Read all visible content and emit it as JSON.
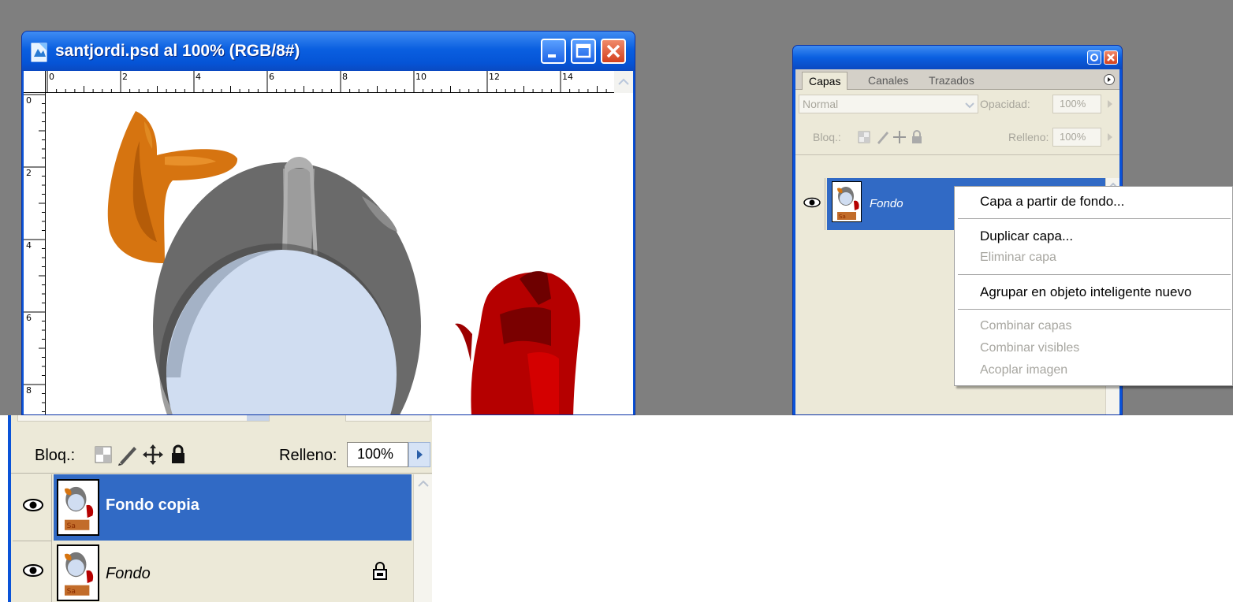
{
  "document_window": {
    "title": "santjordi.psd al 100% (RGB/8#)",
    "ruler_h": [
      "0",
      "2",
      "4",
      "6",
      "8",
      "10",
      "12",
      "14"
    ],
    "ruler_v": [
      "0",
      "2",
      "4",
      "6",
      "8"
    ]
  },
  "layers_panel": {
    "tabs": [
      "Capas",
      "Canales",
      "Trazados"
    ],
    "blend_mode": "Normal",
    "opacity_label": "Opacidad:",
    "opacity_value": "100%",
    "lock_label": "Bloq.:",
    "fill_label": "Relleno:",
    "fill_value": "100%",
    "layers": [
      {
        "name": "Fondo",
        "selected": true,
        "locked": true
      }
    ]
  },
  "context_menu": {
    "items": [
      {
        "label": "Capa a partir de fondo...",
        "enabled": true
      },
      {
        "label": "Duplicar capa...",
        "enabled": true
      },
      {
        "label": "Eliminar capa",
        "enabled": false
      },
      {
        "label": "Agrupar en objeto inteligente nuevo",
        "enabled": true
      },
      {
        "label": "Combinar capas",
        "enabled": false
      },
      {
        "label": "Combinar visibles",
        "enabled": false
      },
      {
        "label": "Acoplar imagen",
        "enabled": false
      }
    ]
  },
  "bottom_panel": {
    "lock_label": "Bloq.:",
    "fill_label": "Relleno:",
    "fill_value": "100%",
    "layers": [
      {
        "name": "Fondo copia",
        "selected": true,
        "locked": false
      },
      {
        "name": "Fondo",
        "selected": false,
        "locked": true
      }
    ]
  },
  "colors": {
    "xp_title_blue": "#0a5fe0",
    "selection_blue": "#316ac5",
    "panel_bg": "#ece9d8",
    "desktop_gray": "#7f7f7f",
    "lens_blue": "#d0ddf1",
    "orange": "#d67410",
    "rose_red": "#b50000"
  },
  "icons": [
    "document-icon",
    "minimize-icon",
    "maximize-icon",
    "close-icon",
    "eye-icon",
    "lock-icon",
    "brush-icon",
    "move-icon",
    "transparency-lock-icon",
    "panel-menu-icon",
    "chevron-down-icon",
    "arrow-right-icon",
    "scroll-up-icon"
  ]
}
